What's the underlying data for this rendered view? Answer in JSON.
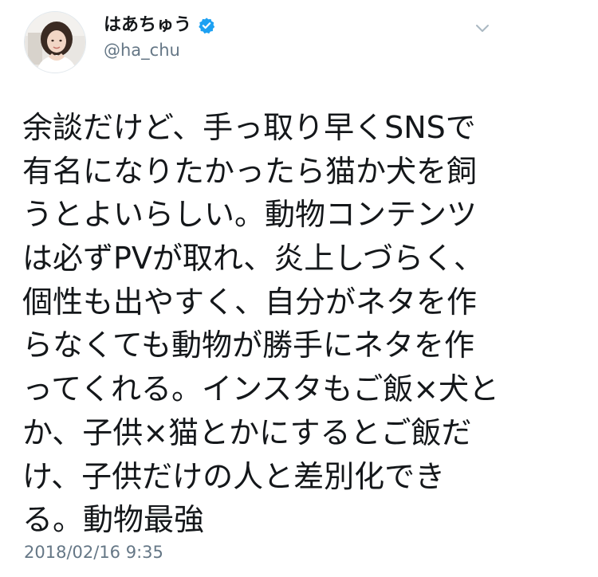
{
  "tweet": {
    "author": {
      "display_name": "はあちゅう",
      "handle": "@ha_chu",
      "verified": true,
      "avatar_icon": "profile-photo"
    },
    "menu_icon": "chevron-down-icon",
    "text_lines": [
      "余談だけど、手っ取り早くSNSで",
      "有名になりたかったら猫か犬を飼",
      "うとよいらしい。動物コンテンツ",
      "は必ずPVが取れ、炎上しづらく、",
      "個性も出やすく、自分がネタを作",
      "らなくても動物が勝手にネタを作",
      "ってくれる。インスタもご飯×犬と",
      "か、子供×猫とかにするとご飯だ",
      "け、子供だけの人と差別化でき",
      "る。動物最強"
    ],
    "timestamp": "2018/02/16 9:35"
  },
  "colors": {
    "text": "#14171a",
    "secondary": "#657786",
    "verified_blue": "#1da1f2",
    "background": "#ffffff"
  }
}
